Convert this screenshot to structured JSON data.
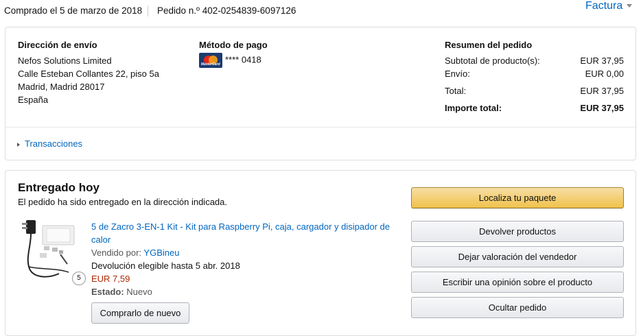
{
  "header": {
    "ordered_on": "Comprado el 5 de marzo de 2018",
    "order_number": "Pedido n.º 402-0254839-6097126",
    "invoice_label": "Factura"
  },
  "shipping": {
    "heading": "Dirección de envío",
    "lines": [
      "Nefos Solutions Limited",
      "Calle Esteban Collantes 22, piso 5a",
      "Madrid, Madrid 28017",
      "España"
    ]
  },
  "payment": {
    "heading": "Método de pago",
    "card_brand": "MasterCard",
    "card_number": "**** 0418"
  },
  "summary": {
    "heading": "Resumen del pedido",
    "subtotal_label": "Subtotal de producto(s):",
    "subtotal_value": "EUR 37,95",
    "shipping_label": "Envío:",
    "shipping_value": "EUR 0,00",
    "total_label": "Total:",
    "total_value": "EUR 37,95",
    "grand_label": "Importe total:",
    "grand_value": "EUR 37,95"
  },
  "transactions_label": "Transacciones",
  "delivery": {
    "status": "Entregado hoy",
    "description": "El pedido ha sido entregado en la dirección indicada."
  },
  "product": {
    "title": "5 de Zacro 3-EN-1 Kit - Kit para Raspberry Pi, caja, cargador y disipador de calor",
    "sold_by_label": "Vendido por:",
    "seller": "YGBineu",
    "return_note": "Devolución elegible hasta 5 abr. 2018",
    "price": "EUR 7,59",
    "condition_label": "Estado:",
    "condition_value": "Nuevo",
    "quantity": "5",
    "buy_again": "Comprarlo de nuevo"
  },
  "actions": {
    "track": "Localiza tu paquete",
    "return": "Devolver productos",
    "seller_feedback": "Dejar valoración del vendedor",
    "review": "Escribir una opinión sobre el producto",
    "hide": "Ocultar pedido"
  },
  "colors": {
    "link": "#0066c0",
    "price": "#b12704",
    "primary_button": "#f0c14b"
  }
}
